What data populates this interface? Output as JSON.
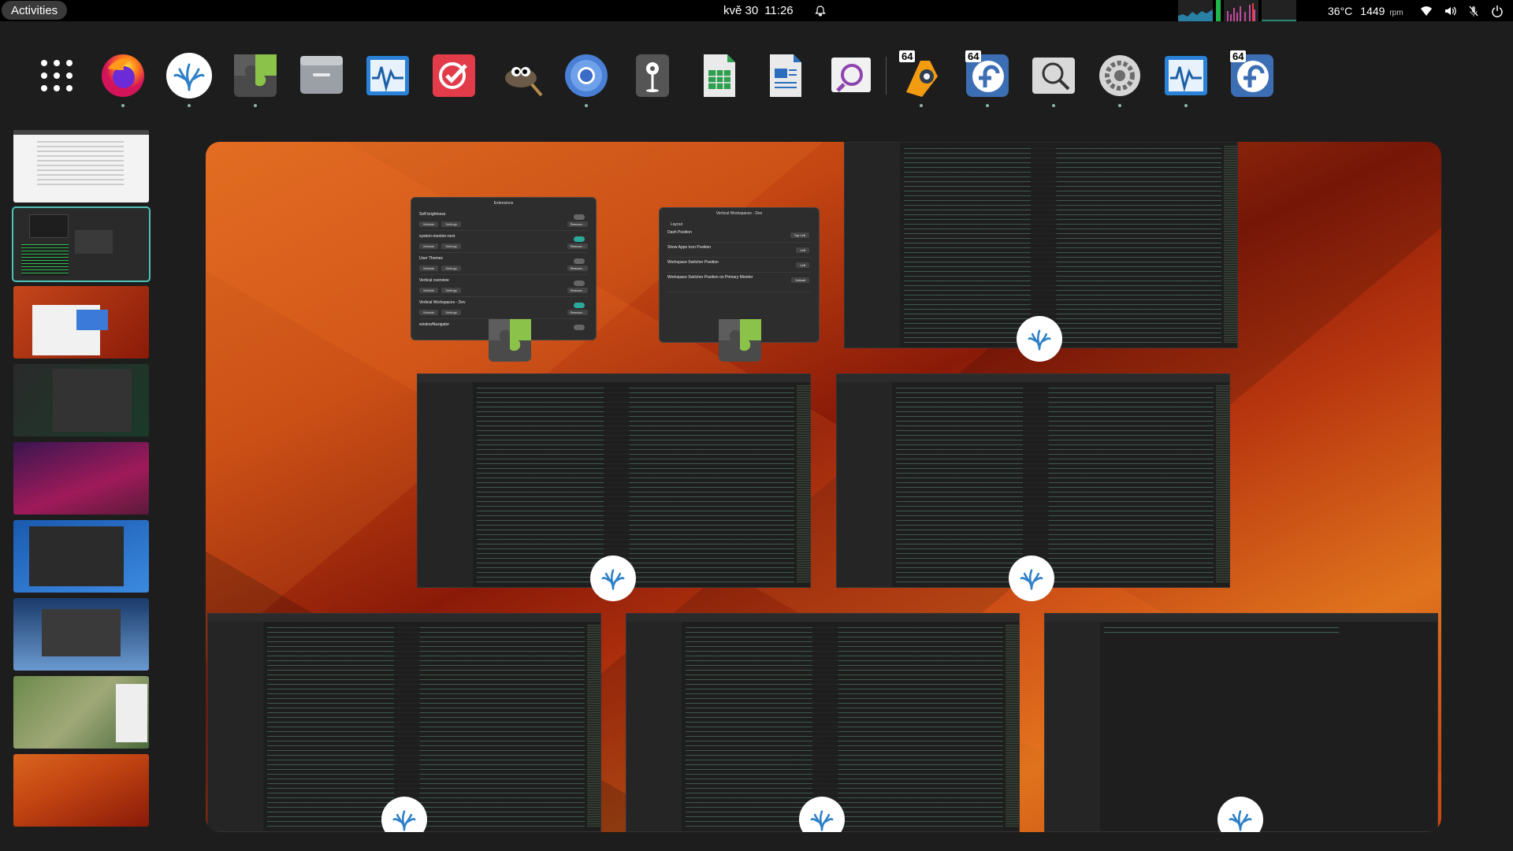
{
  "topbar": {
    "activities_label": "Activities",
    "date": "kvě 30",
    "time": "11:26",
    "temperature": "36°C",
    "fan_speed": "1449",
    "fan_unit": "rpm"
  },
  "dock": {
    "apps": [
      {
        "name": "firefox",
        "badge": ""
      },
      {
        "name": "vscodium",
        "badge": ""
      },
      {
        "name": "extensions",
        "badge": ""
      },
      {
        "name": "files",
        "badge": ""
      },
      {
        "name": "system-monitor",
        "badge": ""
      },
      {
        "name": "todo",
        "badge": ""
      },
      {
        "name": "gimp",
        "badge": ""
      },
      {
        "name": "chromium",
        "badge": ""
      },
      {
        "name": "maps",
        "badge": ""
      },
      {
        "name": "spreadsheet",
        "badge": ""
      },
      {
        "name": "document-writer",
        "badge": ""
      },
      {
        "name": "screenshot",
        "badge": ""
      },
      {
        "name": "blender-like",
        "badge": "64"
      },
      {
        "name": "fedora-media-writer",
        "badge": "64"
      },
      {
        "name": "image-viewer",
        "badge": ""
      },
      {
        "name": "settings",
        "badge": ""
      },
      {
        "name": "system-monitor-2",
        "badge": ""
      },
      {
        "name": "fedora-media-writer-2",
        "badge": "64"
      }
    ]
  },
  "workspaces": {
    "count": 9,
    "active_index": 1
  },
  "windows": {
    "extensions_title": "Extensions",
    "extensions_rows": [
      {
        "name": "Soft brightness",
        "on": false
      },
      {
        "name": "system-monitor-next",
        "on": true
      },
      {
        "name": "User Themes",
        "on": false
      },
      {
        "name": "Vertical overview",
        "on": false
      },
      {
        "name": "Vertical Workspaces - Dev",
        "on": true
      },
      {
        "name": "windowNavigator",
        "on": false
      }
    ],
    "extensions_website_label": "Website",
    "extensions_settings_label": "Settings",
    "extensions_remove_label": "Remove...",
    "vws_title": "Vertical Workspaces - Dev",
    "vws_section": "Layout",
    "vws_rows": [
      {
        "label": "Dash Position",
        "value": "Top Left"
      },
      {
        "label": "Show Apps Icon Position",
        "value": "Left"
      },
      {
        "label": "Workspace Switcher Position",
        "value": "Left"
      },
      {
        "label": "Workspace Switcher Position on Primary Monitor",
        "value": "Default"
      }
    ]
  },
  "colors": {
    "accent": "#4fc3b6",
    "toggle_on": "#2ba89a",
    "wallpaper": "#c44612"
  }
}
